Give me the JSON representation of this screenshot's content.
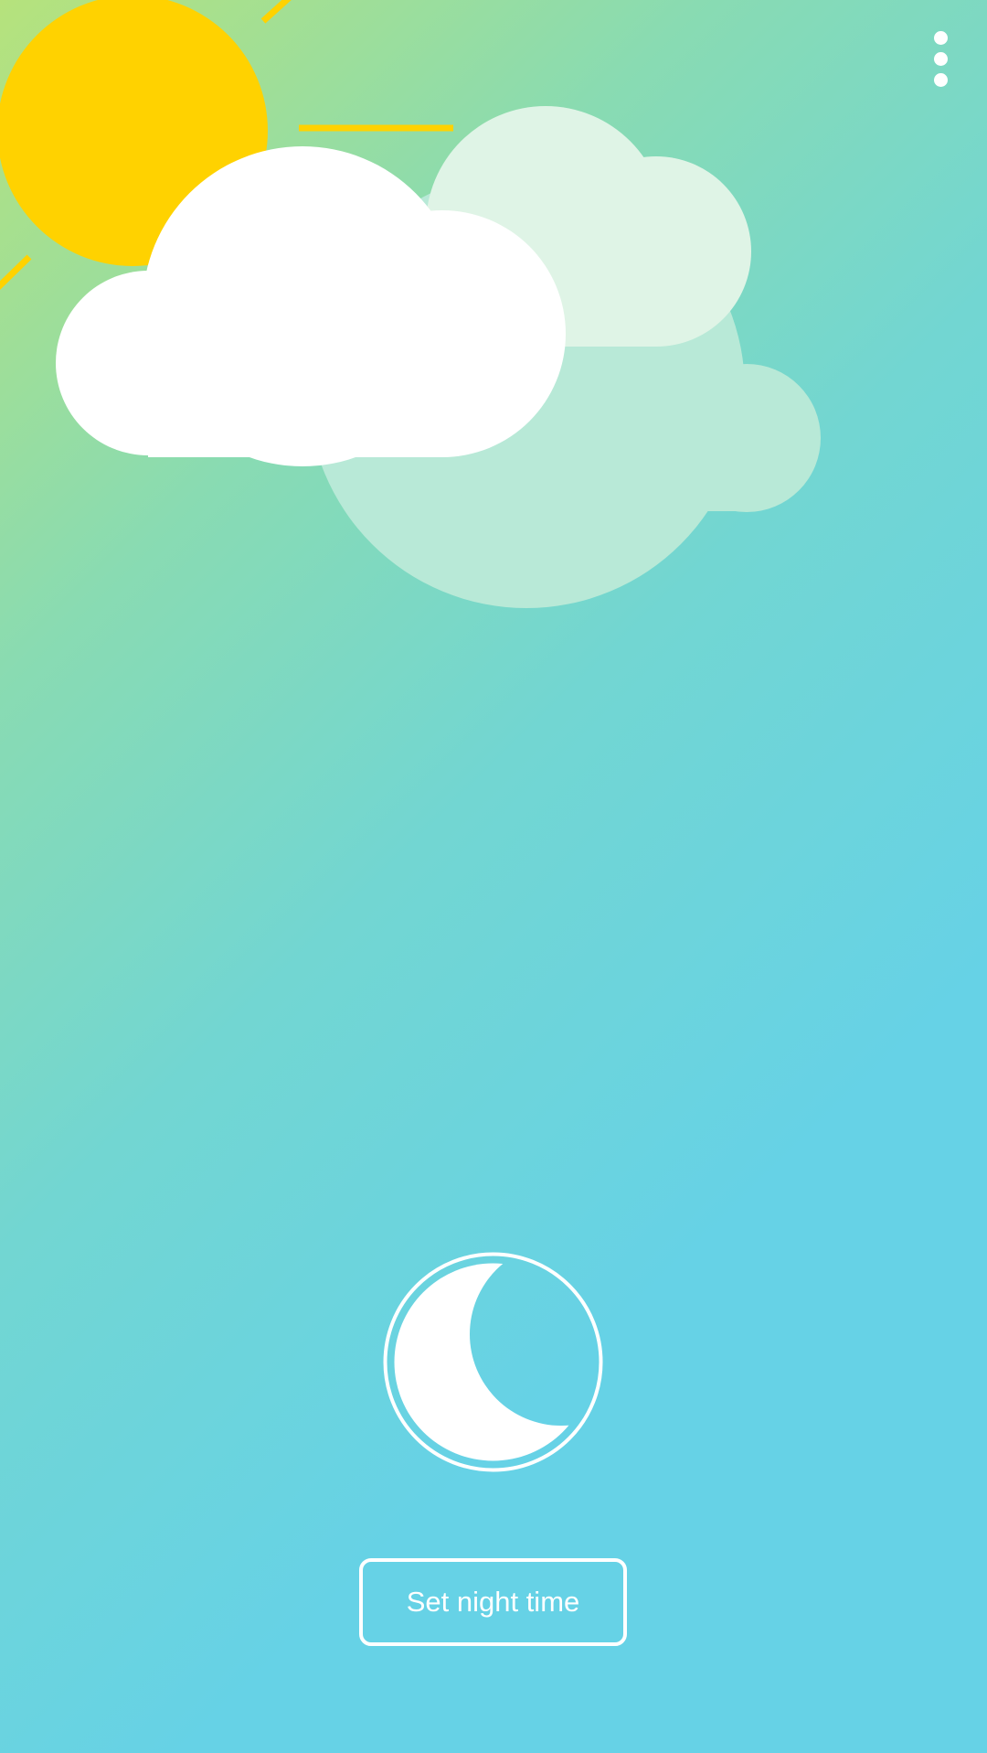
{
  "colors": {
    "background_top": "#b6e27c",
    "background_upper_mid": "#89dbb2",
    "background_mid": "#72d6d2",
    "background_bottom": "#66d2e6",
    "sun": "#ffd200",
    "cloud_front": "#ffffff",
    "cloud_back": "#dff4e6",
    "cloud_rear": "#b8e9d7",
    "foreground": "#ffffff"
  },
  "icons": {
    "menu": "vertical-ellipsis",
    "scene": "sun-behind-clouds",
    "night_mode": "crescent-moon-in-ring"
  },
  "night_mode": {
    "button_label": "Set night time"
  }
}
